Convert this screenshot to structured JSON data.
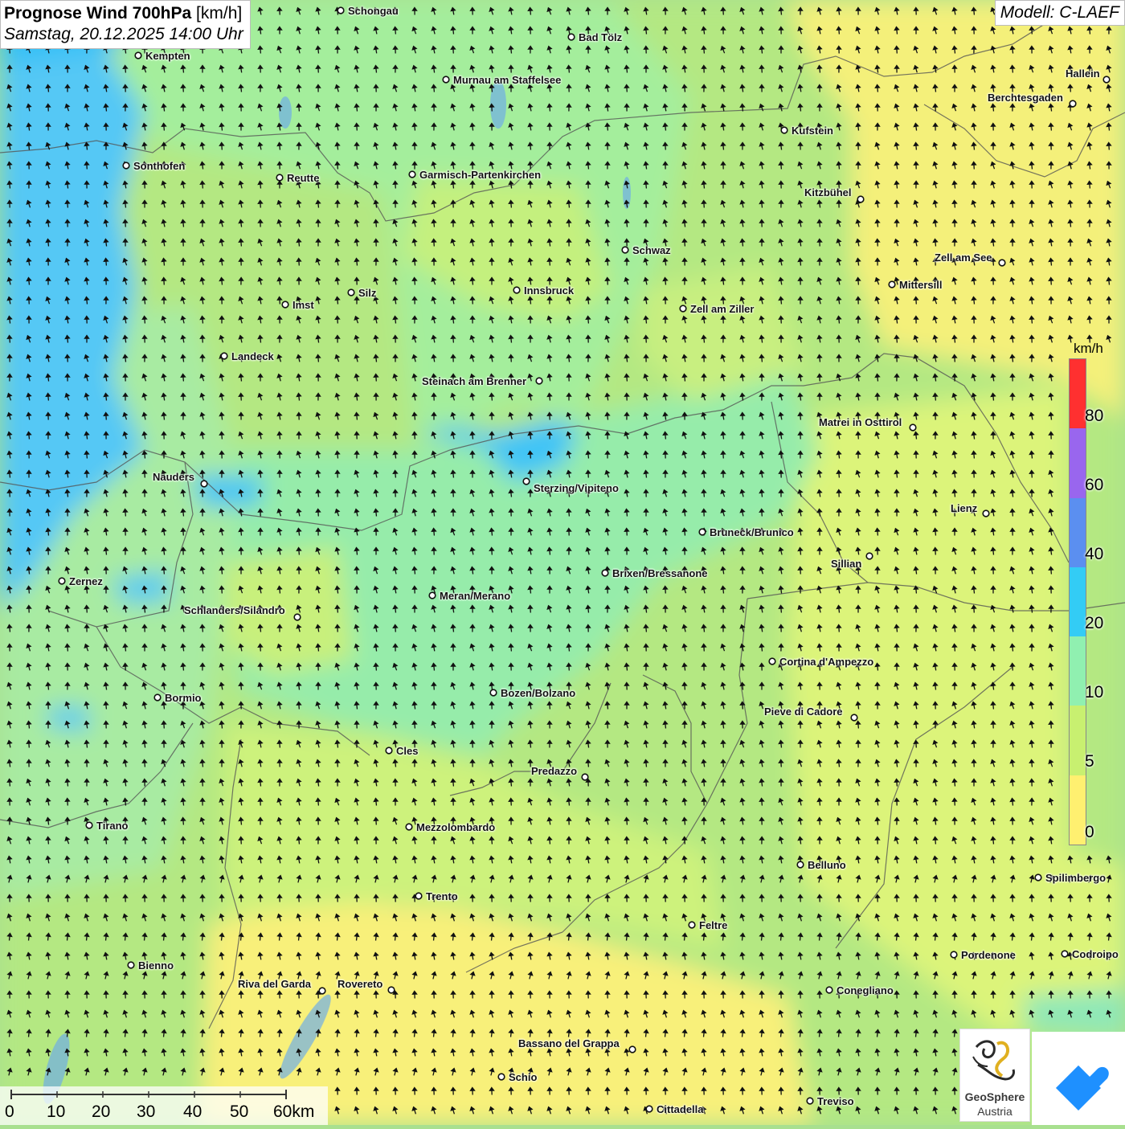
{
  "title": {
    "main": "Prognose Wind 700hPa",
    "unit": "[km/h]",
    "datetime": "Samstag, 20.12.2025 14:00 Uhr"
  },
  "model": "Modell: C-LAEF",
  "legend": {
    "unit": "km/h",
    "labels": [
      "80",
      "60",
      "40",
      "20",
      "10",
      "5",
      "0"
    ],
    "colors": [
      "#ff3030",
      "#9966ee",
      "#5b8ff0",
      "#33ccf5",
      "#90f0b0",
      "#c8f070",
      "#fff070"
    ]
  },
  "scale": {
    "labels": [
      "0",
      "10",
      "20",
      "30",
      "40",
      "50",
      "60km"
    ]
  },
  "logos": {
    "geosphere_line1": "GeoSphere",
    "geosphere_line2": "Austria"
  },
  "cities": [
    "Schongau",
    "Bad Tölz",
    "Kempten",
    "Murnau am Staffelsee",
    "Hallein",
    "Berchtesgaden",
    "Kufstein",
    "Sonthofen",
    "Reutte",
    "Garmisch-Partenkirchen",
    "Kitzbühel",
    "Schwaz",
    "Zell am See",
    "Mittersill",
    "Innsbruck",
    "Silz",
    "Imst",
    "Zell am Ziller",
    "Landeck",
    "Steinach am Brenner",
    "Matrei in Osttirol",
    "Nauders",
    "Sterzing/Vipiteno",
    "Lienz",
    "Bruneck/Brunico",
    "Sillian",
    "Zernez",
    "Brixen/Bressanone",
    "Meran/Merano",
    "Schlanders/Silandro",
    "Cortina d'Ampezzo",
    "Bozen/Bolzano",
    "Bormio",
    "Pieve di Cadore",
    "Cles",
    "Predazzo",
    "Tirano",
    "Mezzolombardo",
    "Belluno",
    "Spilimbergo",
    "Trento",
    "Feltre",
    "Pordenone",
    "Codroipo",
    "Bienno",
    "Riva del Garda",
    "Rovereto",
    "Conegliano",
    "Bassano del Grappa",
    "Schio",
    "Treviso",
    "Cittadella"
  ]
}
